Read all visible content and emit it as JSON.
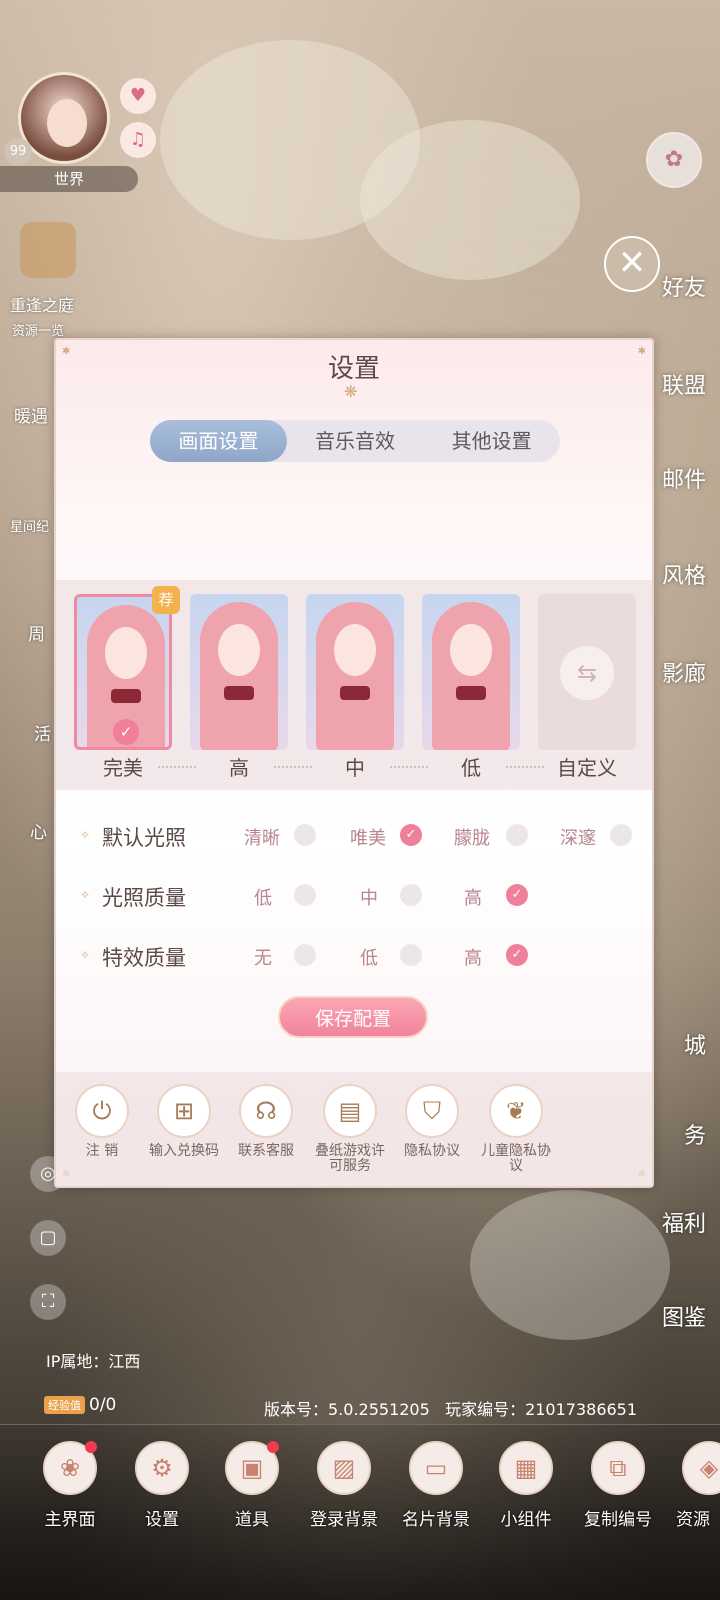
{
  "hud_left": {
    "level": "99",
    "world_label": "世界",
    "event_label": "重逢之庭",
    "resources_label": "资源一览",
    "warm_label": "暖遇",
    "star_label": "星间纪",
    "weekly_label": "周",
    "activity_label": "活",
    "heart_label": "心"
  },
  "hud_right": {
    "friends_label": "好友",
    "alliance_label": "联盟",
    "mail_label": "邮件",
    "style_label": "风格",
    "gallery_label": "影廊",
    "city_label": "城",
    "tasks_label": "务",
    "welfare_label": "福利",
    "codex_label": "图鉴"
  },
  "settings": {
    "title": "设置",
    "tabs": [
      {
        "label": "画面设置",
        "active": true
      },
      {
        "label": "音乐音效",
        "active": false
      },
      {
        "label": "其他设置",
        "active": false
      }
    ],
    "quality_presets": [
      {
        "label": "完美",
        "selected": true,
        "recommended": true
      },
      {
        "label": "高",
        "selected": false
      },
      {
        "label": "中",
        "selected": false
      },
      {
        "label": "低",
        "selected": false
      },
      {
        "label": "自定义",
        "selected": false
      }
    ],
    "recommend_badge": "荐",
    "options": [
      {
        "title": "默认光照",
        "choices": [
          {
            "label": "清晰",
            "checked": false
          },
          {
            "label": "唯美",
            "checked": true
          },
          {
            "label": "朦胧",
            "checked": false
          },
          {
            "label": "深邃",
            "checked": false
          }
        ]
      },
      {
        "title": "光照质量",
        "choices": [
          {
            "label": "低",
            "checked": false
          },
          {
            "label": "中",
            "checked": false
          },
          {
            "label": "高",
            "checked": true
          }
        ]
      },
      {
        "title": "特效质量",
        "choices": [
          {
            "label": "无",
            "checked": false
          },
          {
            "label": "低",
            "checked": false
          },
          {
            "label": "高",
            "checked": true
          }
        ]
      }
    ],
    "save_label": "保存配置",
    "bottom_actions": [
      {
        "label": "注 销",
        "icon": "power-icon"
      },
      {
        "label": "输入兑换码",
        "icon": "gift-icon"
      },
      {
        "label": "联系客服",
        "icon": "headset-icon"
      },
      {
        "label": "叠纸游戏许可服务",
        "icon": "document-icon"
      },
      {
        "label": "隐私协议",
        "icon": "shield-icon"
      },
      {
        "label": "儿童隐私协议",
        "icon": "sprout-icon"
      }
    ]
  },
  "footer": {
    "ip_label": "IP属地：江西",
    "exp_tag": "经验值",
    "exp_value": "0/0",
    "version": "版本号：5.0.2551205",
    "player_id": "玩家编号：21017386651"
  },
  "dock": [
    {
      "label": "主界面",
      "badge": true
    },
    {
      "label": "设置",
      "badge": false
    },
    {
      "label": "道具",
      "badge": true
    },
    {
      "label": "登录背景",
      "badge": false
    },
    {
      "label": "名片背景",
      "badge": false
    },
    {
      "label": "小组件",
      "badge": false
    },
    {
      "label": "复制编号",
      "badge": false
    },
    {
      "label": "资源",
      "badge": false
    }
  ],
  "colors": {
    "accent_pink": "#f07f99",
    "tab_active": "#8ea6c9",
    "gold": "#d6a983"
  }
}
